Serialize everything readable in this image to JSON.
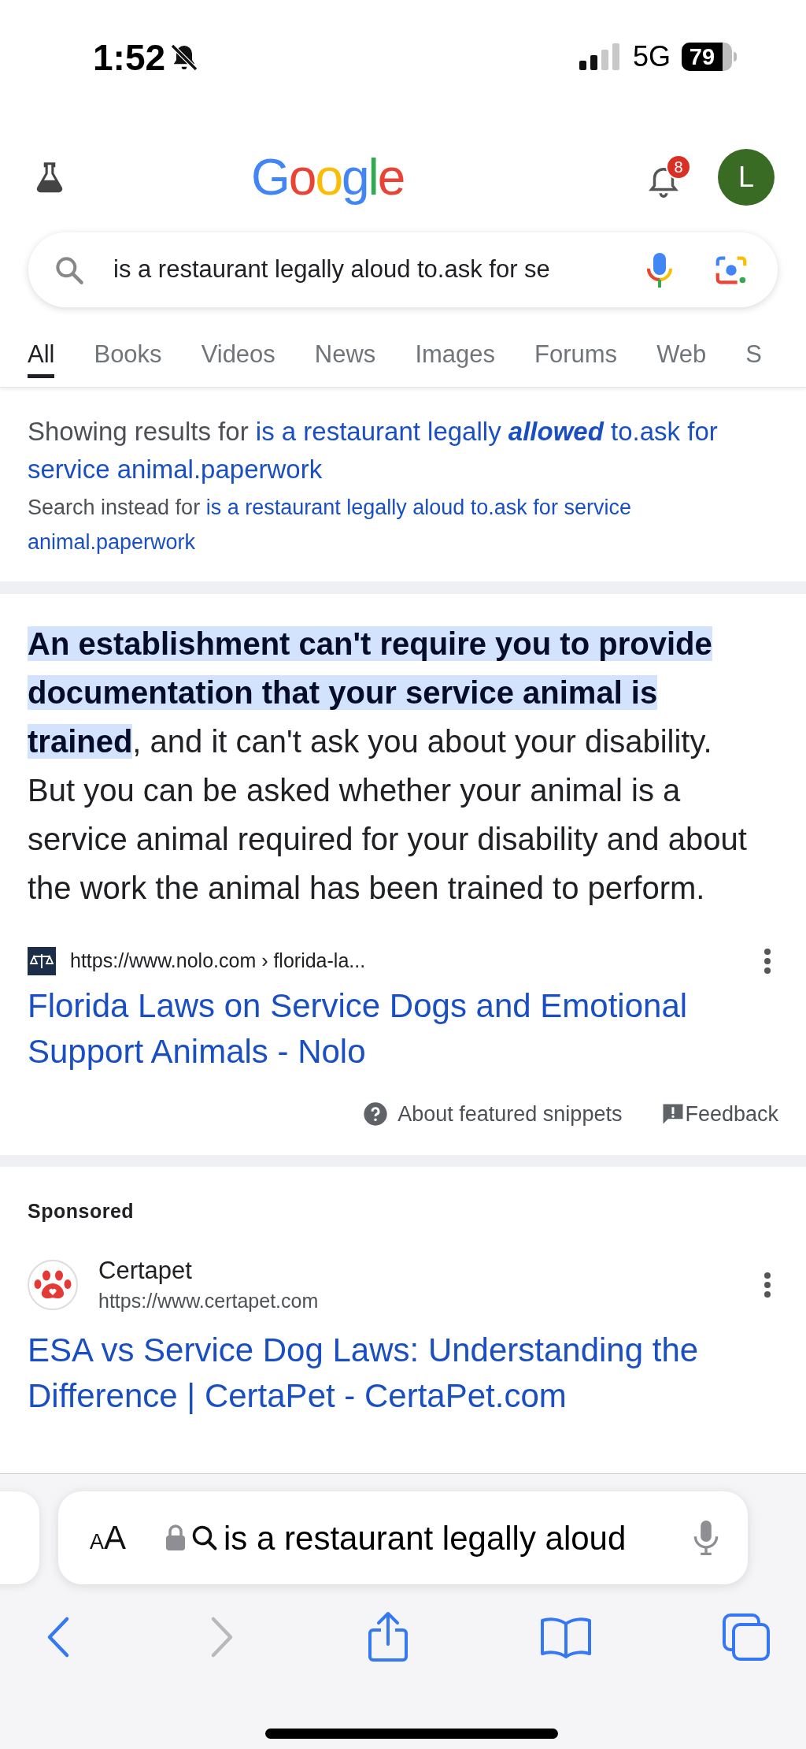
{
  "status_bar": {
    "time": "1:52",
    "network": "5G",
    "battery": "79"
  },
  "header": {
    "logo": "Google",
    "notification_count": "8",
    "avatar_initial": "L"
  },
  "search": {
    "value": "is a restaurant legally aloud to.ask for se"
  },
  "tabs": [
    {
      "label": "All",
      "selected": true
    },
    {
      "label": "Books",
      "selected": false
    },
    {
      "label": "Videos",
      "selected": false
    },
    {
      "label": "News",
      "selected": false
    },
    {
      "label": "Images",
      "selected": false
    },
    {
      "label": "Forums",
      "selected": false
    },
    {
      "label": "Web",
      "selected": false
    },
    {
      "label": "S",
      "selected": false
    }
  ],
  "spelling": {
    "showing_prefix": "Showing results for",
    "corrected_query": "is a restaurant legally **allowed** to.ask for service animal.paperwork",
    "instead_prefix": "Search instead for",
    "original_query": "is a restaurant legally aloud to.ask for service animal.paperwork"
  },
  "featured_snippet": {
    "text": "**An establishment can't require you to provide documentation that your service animal is trained**, and it can't ask you about your disability. But you can be asked whether your animal is a service animal required for your disability and about the work the animal has been trained to perform.",
    "source_url": "https://www.nolo.com › florida-la...",
    "title": "Florida Laws on Service Dogs and Emotional Support Animals - Nolo",
    "about_label": "About featured snippets",
    "feedback_label": "Feedback"
  },
  "sponsored": {
    "label": "Sponsored",
    "advertiser": "Certapet",
    "url": "https://www.certapet.com",
    "title": "ESA vs Service Dog Laws: Understanding the Difference | CertaPet - CertaPet.com"
  },
  "browser_bar": {
    "text_size_label": "AA",
    "address": "is a restaurant legally aloud"
  }
}
